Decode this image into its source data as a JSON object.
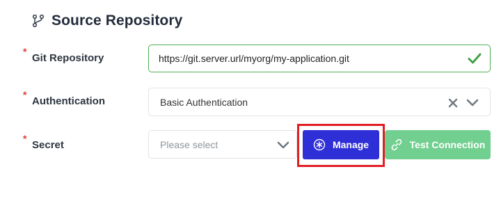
{
  "section": {
    "title": "Source Repository",
    "icon": "git-branch-icon"
  },
  "fields": {
    "git_repository": {
      "label": "Git Repository",
      "required_mark": "*",
      "value": "https://git.server.url/myorg/my-application.git",
      "status_icon": "check-icon"
    },
    "authentication": {
      "label": "Authentication",
      "required_mark": "*",
      "value": "Basic Authentication"
    },
    "secret": {
      "label": "Secret",
      "required_mark": "*",
      "placeholder": "Please select"
    }
  },
  "buttons": {
    "manage": {
      "label": "Manage",
      "icon": "asterisk-circle-icon"
    },
    "test_connection": {
      "label": "Test Connection",
      "icon": "link-icon"
    }
  },
  "colors": {
    "accent_blue": "#2f2fd8",
    "success_green": "#4caf50",
    "test_button_green": "#71cf8f",
    "required_red": "#e53935",
    "highlight_red": "#e11d24"
  }
}
